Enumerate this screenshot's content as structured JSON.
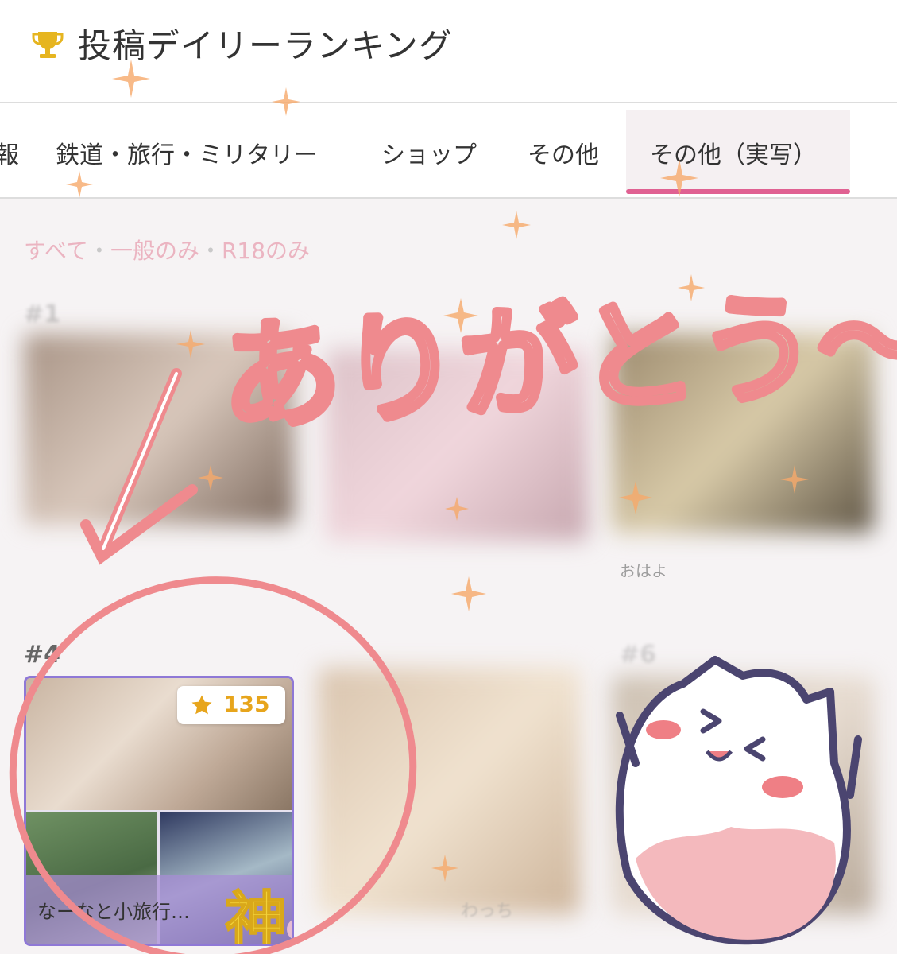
{
  "header": {
    "title": "投稿デイリーランキング",
    "trophy_icon": "trophy-icon",
    "trophy_color": "#e6b520"
  },
  "tabs": [
    {
      "label": "報"
    },
    {
      "label": "鉄道・旅行・ミリタリー"
    },
    {
      "label": "ショップ"
    },
    {
      "label": "その他"
    },
    {
      "label": "その他（実写）",
      "active": true
    }
  ],
  "accent_color": "#e06192",
  "filters": {
    "all": "すべて",
    "separator": "・",
    "general": "一般のみ",
    "r18": "R18のみ"
  },
  "ranks": {
    "first": "#1",
    "fourth": "#4",
    "fifth": "#6"
  },
  "blurred_captions": {
    "card3": "おはよ",
    "card5": "わっち"
  },
  "featured_card": {
    "rank": "#4",
    "stars": "135",
    "star_icon": "star-icon",
    "caption": "なーなと小旅行…",
    "stamp": "神",
    "border_color": "#8f78d6"
  },
  "overlay": {
    "handwritten_text": "ありがとう〜！",
    "arrow": "down-left-arrow",
    "circle": "highlight-circle",
    "mascot": "cat-mascot",
    "ink_color": "#ef8a8e"
  }
}
